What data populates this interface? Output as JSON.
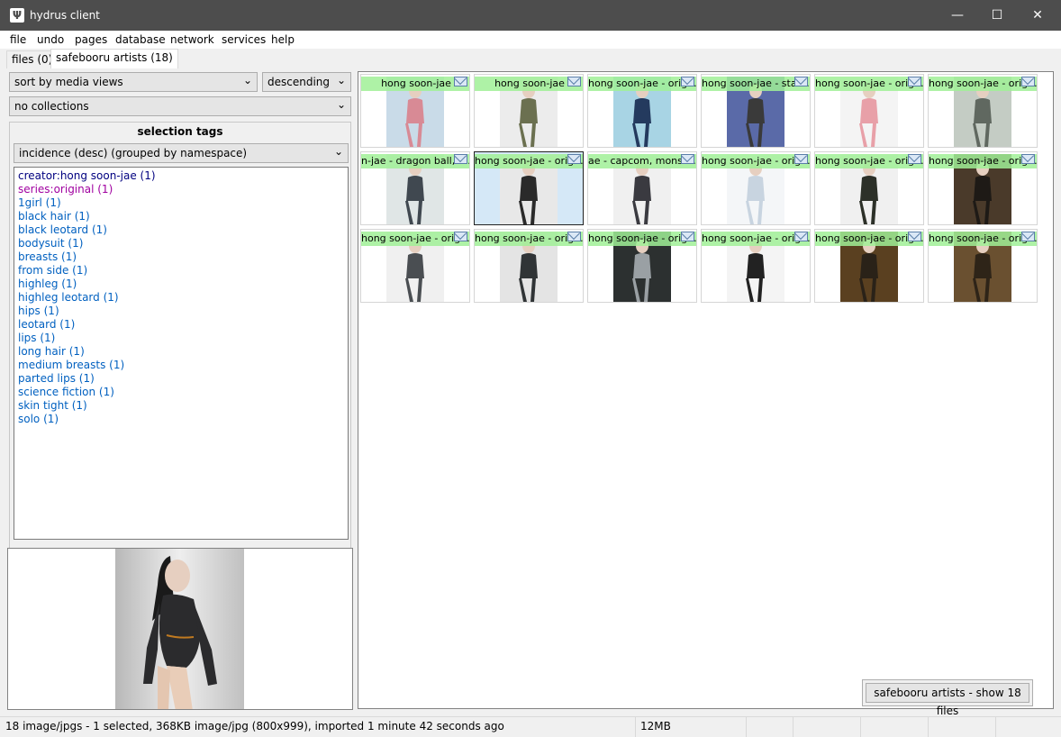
{
  "window": {
    "title": "hydrus client",
    "app_icon": "Ψ",
    "minimize": "—",
    "maximize": "☐",
    "close": "✕"
  },
  "menu": [
    "file",
    "undo",
    "pages",
    "database",
    "network",
    "services",
    "help"
  ],
  "tabs": [
    {
      "label": "files (0)",
      "active": false
    },
    {
      "label": "safebooru artists (18)",
      "active": true
    }
  ],
  "sort": {
    "value": "sort by media views",
    "order": "descending"
  },
  "collections": {
    "value": "no collections"
  },
  "selection_tags": {
    "title": "selection tags",
    "sort": "incidence (desc) (grouped by namespace)",
    "tags": [
      {
        "text": "creator:hong soon-jae (1)",
        "ns": "creator"
      },
      {
        "text": "series:original (1)",
        "ns": "series"
      },
      {
        "text": "1girl (1)",
        "ns": ""
      },
      {
        "text": "black hair (1)",
        "ns": ""
      },
      {
        "text": "black leotard (1)",
        "ns": ""
      },
      {
        "text": "bodysuit (1)",
        "ns": ""
      },
      {
        "text": "breasts (1)",
        "ns": ""
      },
      {
        "text": "from side (1)",
        "ns": ""
      },
      {
        "text": "highleg (1)",
        "ns": ""
      },
      {
        "text": "highleg leotard (1)",
        "ns": ""
      },
      {
        "text": "hips (1)",
        "ns": ""
      },
      {
        "text": "leotard (1)",
        "ns": ""
      },
      {
        "text": "lips (1)",
        "ns": ""
      },
      {
        "text": "long hair (1)",
        "ns": ""
      },
      {
        "text": "medium breasts (1)",
        "ns": ""
      },
      {
        "text": "parted lips (1)",
        "ns": ""
      },
      {
        "text": "science fiction (1)",
        "ns": ""
      },
      {
        "text": "skin tight (1)",
        "ns": ""
      },
      {
        "text": "solo (1)",
        "ns": ""
      }
    ]
  },
  "thumbnails": [
    {
      "label": "hong soon-jae",
      "align": "center",
      "bg": "#c9dbe8",
      "fig": "#d88a95",
      "selected": false
    },
    {
      "label": "hong soon-jae",
      "align": "center",
      "bg": "#ececec",
      "fig": "#6b7050",
      "selected": false
    },
    {
      "label": "hong soon-jae - orig...",
      "align": "left",
      "bg": "#a8d4e4",
      "fig": "#243a5e",
      "selected": false
    },
    {
      "label": "hong soon-jae - star...",
      "align": "left",
      "bg": "#5a6aa8",
      "fig": "#3a3a3a",
      "selected": false
    },
    {
      "label": "hong soon-jae - orig...",
      "align": "left",
      "bg": "#f4f4f4",
      "fig": "#e8a0a8",
      "selected": false
    },
    {
      "label": "hong soon-jae - orig...",
      "align": "left",
      "bg": "#c4ccc4",
      "fig": "#606860",
      "selected": false
    },
    {
      "label": "n-jae - dragon ball, d...",
      "align": "left",
      "bg": "#e0e6e6",
      "fig": "#404850",
      "selected": false
    },
    {
      "label": "hong soon-jae - orig...",
      "align": "left",
      "bg": "#e8e8e8",
      "fig": "#2a2a2a",
      "selected": true
    },
    {
      "label": "ae - capcom, monst...",
      "align": "left",
      "bg": "#f0f0f0",
      "fig": "#3a3a40",
      "selected": false
    },
    {
      "label": "hong soon-jae - orig...",
      "align": "left",
      "bg": "#f4f6f8",
      "fig": "#c8d4e0",
      "selected": false
    },
    {
      "label": "hong soon-jae - orig...",
      "align": "left",
      "bg": "#f0f0f0",
      "fig": "#2c3028",
      "selected": false
    },
    {
      "label": "hong soon-jae - orig...",
      "align": "left",
      "bg": "#4a3a2a",
      "fig": "#1e1a16",
      "selected": false
    },
    {
      "label": "hong soon-jae - orig...",
      "align": "left",
      "bg": "#f0f0f0",
      "fig": "#4a4e52",
      "selected": false
    },
    {
      "label": "hong soon-jae - orig...",
      "align": "left",
      "bg": "#e4e4e4",
      "fig": "#303436",
      "selected": false
    },
    {
      "label": "hong soon-jae - orig...",
      "align": "left",
      "bg": "#2c3030",
      "fig": "#9aa0a4",
      "selected": false
    },
    {
      "label": "hong soon-jae - orig...",
      "align": "left",
      "bg": "#f4f4f4",
      "fig": "#222222",
      "selected": false
    },
    {
      "label": "hong soon-jae - orig...",
      "align": "left",
      "bg": "#5a4020",
      "fig": "#2a2218",
      "selected": false
    },
    {
      "label": "hong soon-jae - orig...",
      "align": "left",
      "bg": "#6a5030",
      "fig": "#2e2418",
      "selected": false
    }
  ],
  "popup": {
    "label": "safebooru artists - show 18 files"
  },
  "status": {
    "text": "18 image/jpgs - 1 selected, 368KB image/jpg (800x999), imported 1 minute 42 seconds ago",
    "memory": "12MB"
  },
  "colors": {
    "title_bg": "#4d4d4d",
    "banner": "#a0f096",
    "tag_default": "#0060c0",
    "tag_creator": "#000080",
    "tag_series": "#a000a0"
  }
}
